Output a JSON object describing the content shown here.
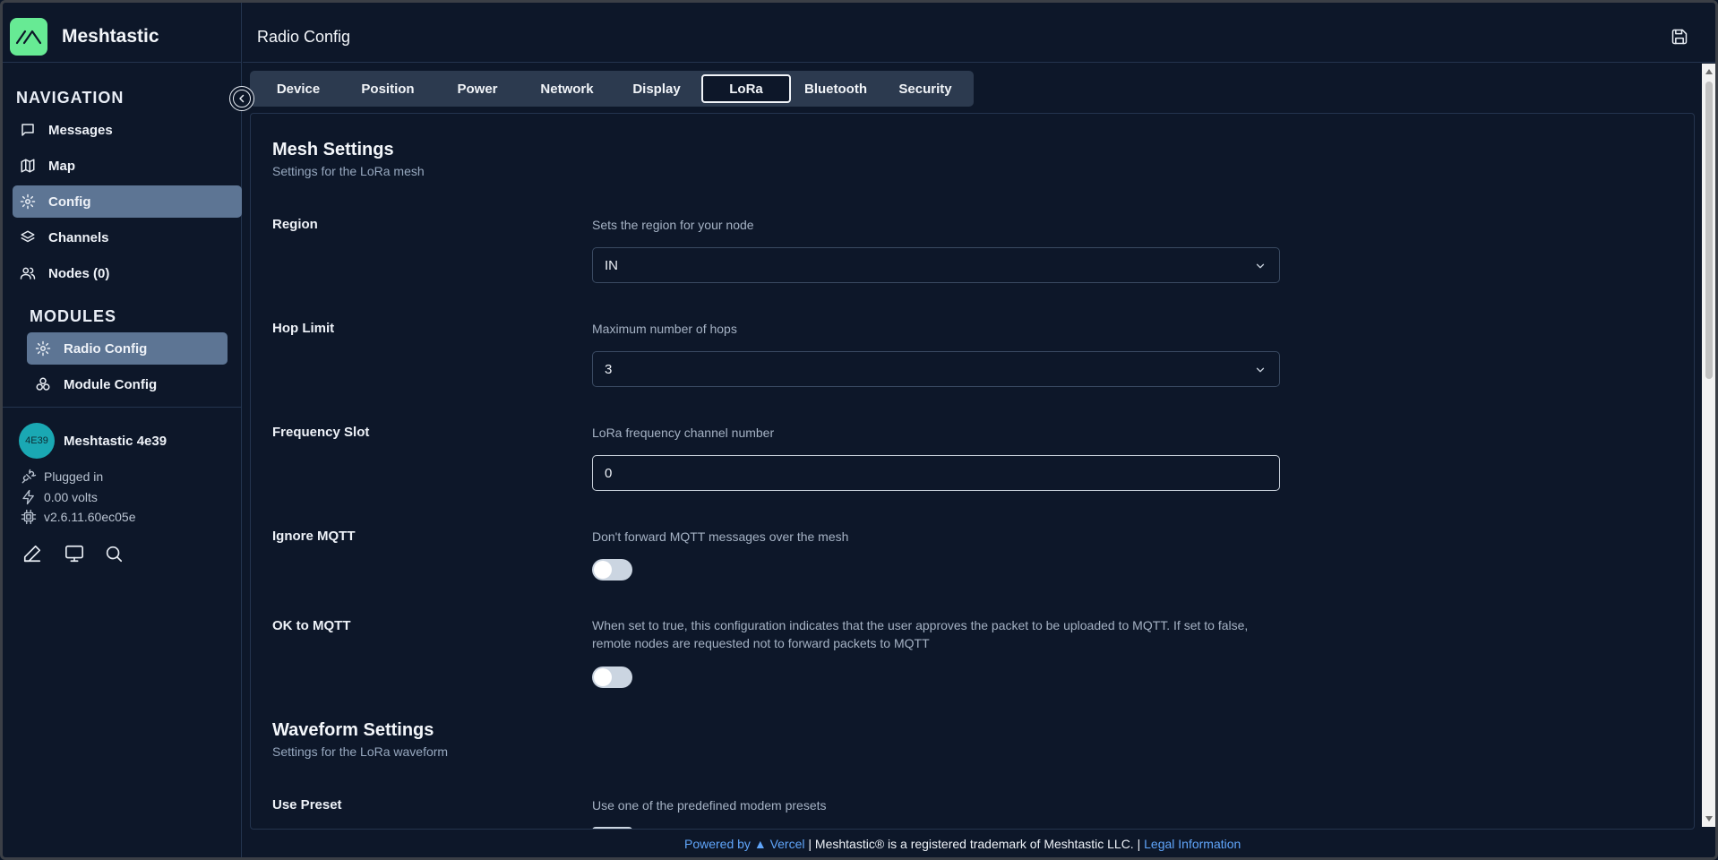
{
  "app": {
    "name": "Meshtastic"
  },
  "sidebar": {
    "navigation_title": "NAVIGATION",
    "nav_items": [
      {
        "label": "Messages",
        "icon": "message-icon"
      },
      {
        "label": "Map",
        "icon": "map-icon"
      },
      {
        "label": "Config",
        "icon": "gear-icon",
        "active": true
      },
      {
        "label": "Channels",
        "icon": "layers-icon"
      },
      {
        "label": "Nodes (0)",
        "icon": "users-icon"
      }
    ],
    "modules_title": "MODULES",
    "module_items": [
      {
        "label": "Radio Config",
        "icon": "gear-icon",
        "active": true
      },
      {
        "label": "Module Config",
        "icon": "boxes-icon"
      }
    ],
    "node": {
      "avatar_text": "4E39",
      "name": "Meshtastic 4e39",
      "power_status": "Plugged in",
      "voltage": "0.00 volts",
      "firmware": "v2.6.11.60ec05e"
    }
  },
  "header": {
    "title": "Radio Config"
  },
  "tabs": [
    {
      "label": "Device"
    },
    {
      "label": "Position"
    },
    {
      "label": "Power"
    },
    {
      "label": "Network"
    },
    {
      "label": "Display"
    },
    {
      "label": "LoRa",
      "active": true
    },
    {
      "label": "Bluetooth"
    },
    {
      "label": "Security"
    }
  ],
  "mesh": {
    "title": "Mesh Settings",
    "subtitle": "Settings for the LoRa mesh",
    "region": {
      "label": "Region",
      "description": "Sets the region for your node",
      "value": "IN"
    },
    "hop_limit": {
      "label": "Hop Limit",
      "description": "Maximum number of hops",
      "value": "3"
    },
    "frequency_slot": {
      "label": "Frequency Slot",
      "description": "LoRa frequency channel number",
      "value": "0"
    },
    "ignore_mqtt": {
      "label": "Ignore MQTT",
      "description": "Don't forward MQTT messages over the mesh",
      "checked": false
    },
    "ok_to_mqtt": {
      "label": "OK to MQTT",
      "description": "When set to true, this configuration indicates that the user approves the packet to be uploaded to MQTT. If set to false, remote nodes are requested not to forward packets to MQTT",
      "checked": false
    }
  },
  "waveform": {
    "title": "Waveform Settings",
    "subtitle": "Settings for the LoRa waveform",
    "use_preset": {
      "label": "Use Preset",
      "description": "Use one of the predefined modem presets"
    }
  },
  "footer": {
    "powered_by": "Powered by ▲ Vercel",
    "trademark": "Meshtastic® is a registered trademark of Meshtastic LLC.",
    "legal": "Legal Information"
  },
  "colors": {
    "background": "#0d1729",
    "brand_green": "#67ea94",
    "active_nav": "#5d7594",
    "link": "#60a5fa",
    "avatar": "#1aa8b3"
  }
}
